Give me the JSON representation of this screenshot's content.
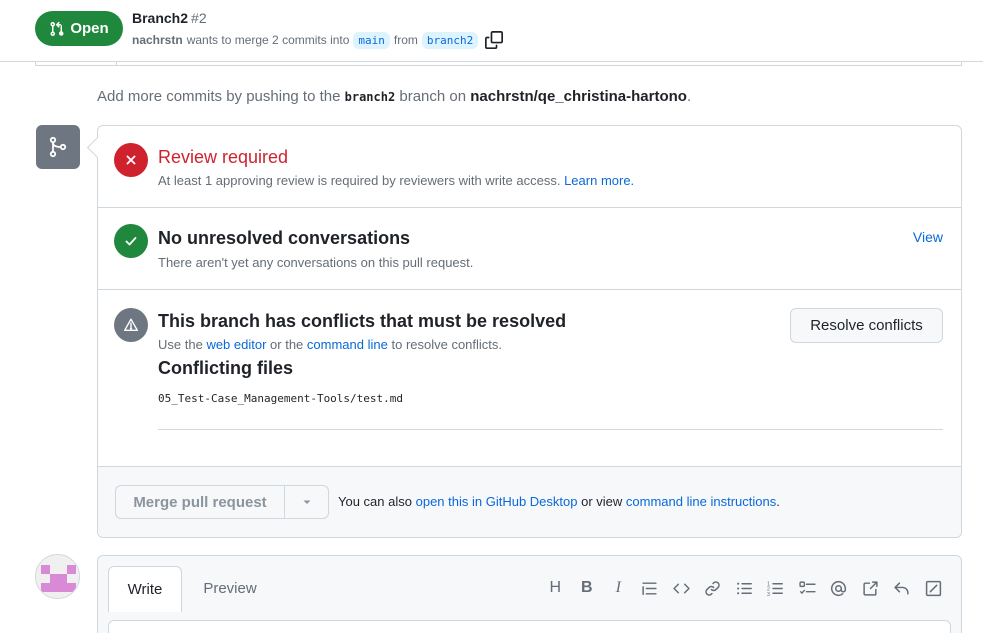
{
  "header": {
    "state": "Open",
    "title": "Branch2",
    "number": "#2",
    "author": "nachrstn",
    "merge_text": "wants to merge 2 commits into",
    "base_branch": "main",
    "from_text": "from",
    "head_branch": "branch2"
  },
  "push_note": {
    "prefix": "Add more commits by pushing to the",
    "branch": "branch2",
    "middle": "branch on",
    "repo": "nachrstn/qe_christina-hartono",
    "suffix": "."
  },
  "checks": {
    "review": {
      "title": "Review required",
      "desc": "At least 1 approving review is required by reviewers with write access.",
      "link": "Learn more."
    },
    "conversations": {
      "title": "No unresolved conversations",
      "desc": "There aren't yet any conversations on this pull request.",
      "link": "View"
    },
    "conflicts": {
      "title": "This branch has conflicts that must be resolved",
      "desc_prefix": "Use the",
      "web_editor": "web editor",
      "desc_mid": "or the",
      "command_line": "command line",
      "desc_suffix": "to resolve conflicts.",
      "button": "Resolve conflicts",
      "files_title": "Conflicting files",
      "files": [
        "05_Test-Case_Management-Tools/test.md"
      ]
    }
  },
  "merge": {
    "button": "Merge pull request",
    "note_prefix": "You can also",
    "desktop_link": "open this in GitHub Desktop",
    "note_mid": "or view",
    "cli_link": "command line instructions",
    "note_suffix": "."
  },
  "comment": {
    "tab_write": "Write",
    "tab_preview": "Preview",
    "toolbar": [
      "heading",
      "bold",
      "italic",
      "quote",
      "code",
      "link",
      "unordered-list",
      "ordered-list",
      "task-list",
      "mention",
      "cross-reference",
      "reply",
      "fullscreen"
    ]
  },
  "colors": {
    "open_green": "#1f883d",
    "danger_red": "#cf222e",
    "link_blue": "#0969da",
    "muted_grey": "#6e7781"
  }
}
